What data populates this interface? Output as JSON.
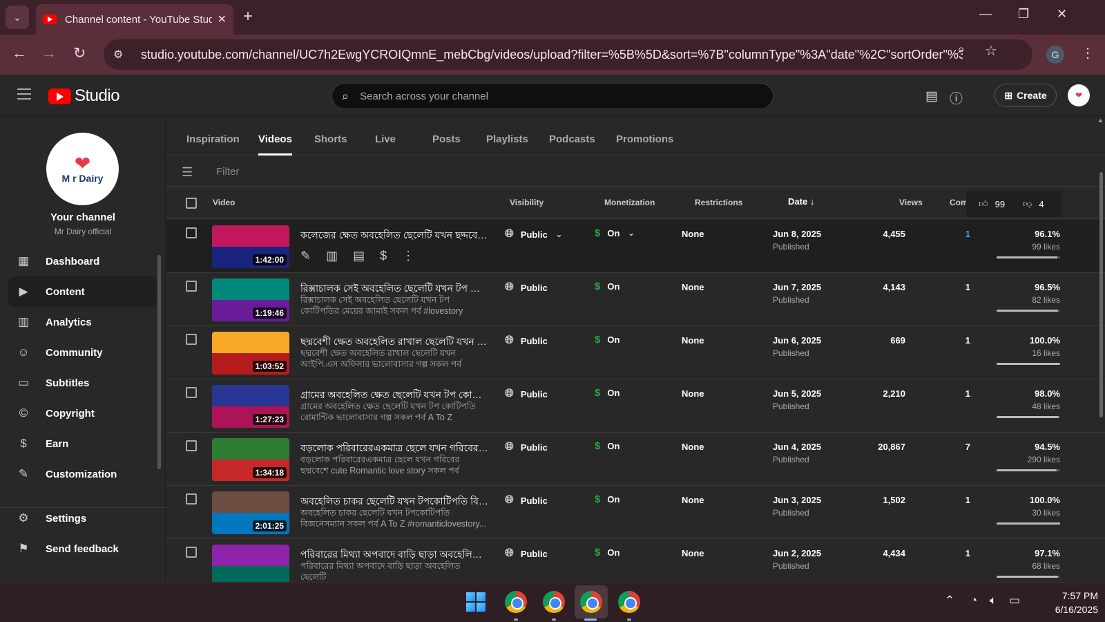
{
  "browser": {
    "tab_title": "Channel content - YouTube Studio",
    "url": "studio.youtube.com/channel/UC7h2EwgYCROIQmnE_mebCbg/videos/upload?filter=%5B%5D&sort=%7B\"columnType\"%3A\"date\"%2C\"sortOrder\"%3A\"DE...",
    "profile_initial": "G"
  },
  "header": {
    "logo_text": "Studio",
    "search_placeholder": "Search across your channel",
    "create_label": "Create"
  },
  "sidebar": {
    "avatar_name": "M r Dairy",
    "your_channel": "Your channel",
    "channel_name": "Mr Dairy official",
    "items": [
      {
        "label": "Dashboard",
        "icon": "dashboard-icon"
      },
      {
        "label": "Content",
        "icon": "content-icon"
      },
      {
        "label": "Analytics",
        "icon": "analytics-icon"
      },
      {
        "label": "Community",
        "icon": "community-icon"
      },
      {
        "label": "Subtitles",
        "icon": "subtitles-icon"
      },
      {
        "label": "Copyright",
        "icon": "copyright-icon"
      },
      {
        "label": "Earn",
        "icon": "earn-icon"
      },
      {
        "label": "Customization",
        "icon": "customization-icon"
      }
    ],
    "bottom": [
      {
        "label": "Settings",
        "icon": "settings-icon"
      },
      {
        "label": "Send feedback",
        "icon": "feedback-icon"
      }
    ]
  },
  "content_tabs": [
    "Inspiration",
    "Videos",
    "Shorts",
    "Live",
    "Posts",
    "Playlists",
    "Podcasts",
    "Promotions"
  ],
  "filter_placeholder": "Filter",
  "columns": {
    "video": "Video",
    "visibility": "Visibility",
    "monetization": "Monetization",
    "restrictions": "Restrictions",
    "date": "Date",
    "views": "Views",
    "comments": "Comment"
  },
  "likes_popup": {
    "likes": "99",
    "dislikes": "4"
  },
  "videos": [
    {
      "title": "কলেজের ক্ষেত অবহেলিত ছেলেটি যখন ছদ্দবেশি পু...",
      "desc": "",
      "duration": "1:42:00",
      "visibility": "Public",
      "monetization": "On",
      "restrictions": "None",
      "date": "Jun 8, 2025",
      "status": "Published",
      "views": "4,455",
      "comments": "1",
      "like_pct": "96.1%",
      "likes": "99 likes",
      "like_ratio": 0.961,
      "thumb_top": "#c2185b",
      "thumb_bot": "#1a237e"
    },
    {
      "title": "রিক্সাচালক সেই অবহেলিত ছেলেটি যখন টপ কোটি...",
      "desc": "রিক্সাচালক সেই অবহেলিত ছেলেটি যখন টপ কোটিপতির মেয়ের জামাই সকল পর্ব #lovestory #lovestorybangla...",
      "duration": "1:19:46",
      "visibility": "Public",
      "monetization": "On",
      "restrictions": "None",
      "date": "Jun 7, 2025",
      "status": "Published",
      "views": "4,143",
      "comments": "1",
      "like_pct": "96.5%",
      "likes": "82 likes",
      "like_ratio": 0.965,
      "thumb_top": "#00897b",
      "thumb_bot": "#6a1b9a"
    },
    {
      "title": "ছদ্মবেশী ক্ষেত অবহেলিত রাখাল ছেলেটি যখন আই...",
      "desc": "ছদ্মবেশী ক্ষেত অবহেলিত রাখাল ছেলেটি যখন আইপি.এস অফিসার ভালোবাসার গল্প সকল পর্ব #lovestory...",
      "duration": "1:03:52",
      "visibility": "Public",
      "monetization": "On",
      "restrictions": "None",
      "date": "Jun 6, 2025",
      "status": "Published",
      "views": "669",
      "comments": "1",
      "like_pct": "100.0%",
      "likes": "16 likes",
      "like_ratio": 1.0,
      "thumb_top": "#f9a825",
      "thumb_bot": "#b71c1c"
    },
    {
      "title": "গ্রামের অবহেলিত ক্ষেত ছেলেটি যখন টপ কোটিপতি...",
      "desc": "গ্রামের অবহেলিত ক্ষেত ছেলেটি যখন টপ কোটিপতি রোমান্টিক ভালোবাসার গল্প সকল পর্ব A To Z #lovestor...",
      "duration": "1:27:23",
      "visibility": "Public",
      "monetization": "On",
      "restrictions": "None",
      "date": "Jun 5, 2025",
      "status": "Published",
      "views": "2,210",
      "comments": "1",
      "like_pct": "98.0%",
      "likes": "48 likes",
      "like_ratio": 0.98,
      "thumb_top": "#283593",
      "thumb_bot": "#ad1457"
    },
    {
      "title": "বড়লোক পরিবারেরএকমাত্র ছেলে যখন গরিবের ছদ্ম...",
      "desc": "বড়লোক পরিবারেরএকমাত্র ছেলে যখন গরিবের ছদ্মবেশে cute Romantic love story সকল পর্ব #lovestory...",
      "duration": "1:34:18",
      "visibility": "Public",
      "monetization": "On",
      "restrictions": "None",
      "date": "Jun 4, 2025",
      "status": "Published",
      "views": "20,867",
      "comments": "7",
      "like_pct": "94.5%",
      "likes": "290 likes",
      "like_ratio": 0.945,
      "thumb_top": "#2e7d32",
      "thumb_bot": "#c62828"
    },
    {
      "title": "অবহেলিত চাকর ছেলেটি যখন টপকোটিপতি বিজ...",
      "desc": "অবহেলিত চাকর ছেলেটি যখন টপকোটিপতি বিজনেসম্যান সকল পর্ব A To Z #romanticlovestory...",
      "duration": "2:01:25",
      "visibility": "Public",
      "monetization": "On",
      "restrictions": "None",
      "date": "Jun 3, 2025",
      "status": "Published",
      "views": "1,502",
      "comments": "1",
      "like_pct": "100.0%",
      "likes": "30 likes",
      "like_ratio": 1.0,
      "thumb_top": "#6d4c41",
      "thumb_bot": "#0277bd"
    },
    {
      "title": "পরিবারের মিথ্যা অপবাদে বাড়ি ছাড়া অবহেলিত ছে...",
      "desc": "পরিবারের মিথ্যা অপবাদে বাড়ি ছাড়া অবহেলিত ছেলেটি",
      "duration": "",
      "visibility": "Public",
      "monetization": "On",
      "restrictions": "None",
      "date": "Jun 2, 2025",
      "status": "Published",
      "views": "4,434",
      "comments": "1",
      "like_pct": "97.1%",
      "likes": "68 likes",
      "like_ratio": 0.971,
      "thumb_top": "#8e24aa",
      "thumb_bot": "#00695c"
    }
  ],
  "taskbar": {
    "time": "7:57 PM",
    "date": "6/16/2025"
  }
}
